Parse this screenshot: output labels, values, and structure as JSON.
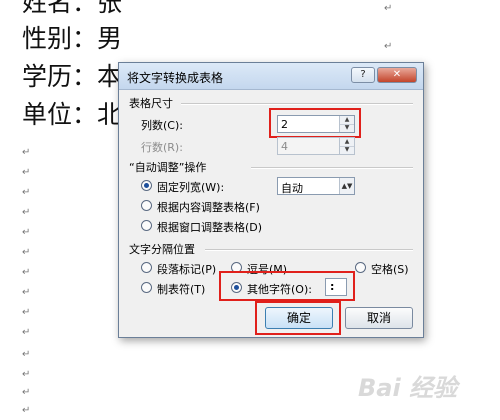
{
  "document": {
    "lines": [
      "姓名：张",
      "性别：男",
      "学历：本",
      "单位：北"
    ],
    "paragraph_mark": "↵"
  },
  "dialog": {
    "title": "将文字转换成表格",
    "help_icon": "?",
    "close_icon": "✕",
    "table_size": {
      "heading": "表格尺寸",
      "columns_label": "列数(C):",
      "columns_value": "2",
      "rows_label": "行数(R):",
      "rows_value": "4"
    },
    "autofit": {
      "heading": "“自动调整”操作",
      "fixed_width_label": "固定列宽(W):",
      "fixed_width_value": "自动",
      "fit_content_label": "根据内容调整表格(F)",
      "fit_window_label": "根据窗口调整表格(D)",
      "selected": "fixed_width"
    },
    "separator": {
      "heading": "文字分隔位置",
      "paragraph_label": "段落标记(P)",
      "comma_label": "逗号(M)",
      "space_label": "空格(S)",
      "tab_label": "制表符(T)",
      "other_label": "其他字符(O):",
      "other_value": ":",
      "selected": "other"
    },
    "ok_label": "确定",
    "cancel_label": "取消"
  },
  "highlight_color": "#e0201b",
  "accent_color": "#3c7fb1",
  "watermark": "Bai 经验"
}
